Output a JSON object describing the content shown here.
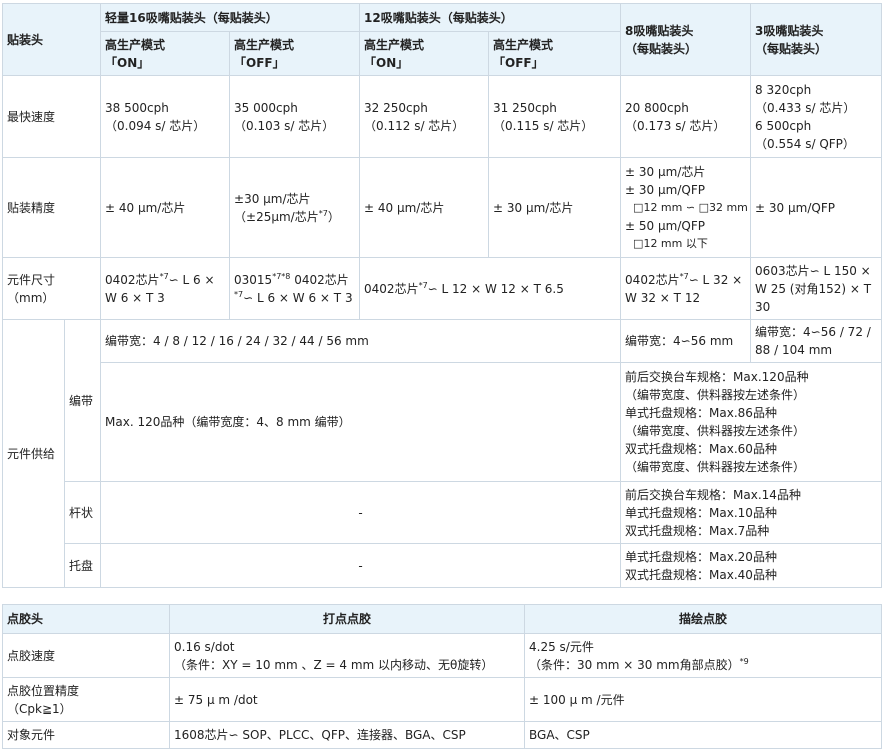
{
  "mount_table": {
    "corner": "贴装头",
    "head16": "轻量16吸嘴贴装头（每贴装头）",
    "head12": "12吸嘴贴装头（每贴装头）",
    "head8": [
      "8吸嘴贴装头",
      "（每贴装头）"
    ],
    "head3": [
      "3吸嘴贴装头",
      "（每贴装头）"
    ],
    "mode_on": [
      "高生产模式",
      "「ON」"
    ],
    "mode_off": [
      "高生产模式",
      "「OFF」"
    ],
    "rows": {
      "speed": {
        "label": "最快速度",
        "c16on": [
          "38 500cph",
          "（0.094 s/ 芯片）"
        ],
        "c16off": [
          "35 000cph",
          "（0.103 s/ 芯片）"
        ],
        "c12on": [
          "32 250cph",
          "（0.112 s/ 芯片）"
        ],
        "c12off": [
          "31 250cph",
          "（0.115 s/ 芯片）"
        ],
        "c8": [
          "20 800cph",
          "（0.173 s/ 芯片）"
        ],
        "c3": [
          "8 320cph",
          "（0.433 s/ 芯片）",
          "6 500cph",
          "（0.554 s/ QFP）"
        ]
      },
      "accuracy": {
        "label": "贴装精度",
        "c16on": "± 40 μm/芯片",
        "c16off_1": "±30 μm/芯片",
        "c16off_2": "（±25μm/芯片",
        "c16off_sup": "*7",
        "c16off_3": "）",
        "c12on": "± 40 μm/芯片",
        "c12off": "± 30 μm/芯片",
        "c8": [
          "± 30 μm/芯片",
          "± 30 μm/QFP",
          "□12 mm ∽ □32 mm",
          "± 50 μm/QFP",
          "□12 mm 以下"
        ],
        "c3": "± 30 μm/QFP"
      },
      "size": {
        "label": [
          "元件尺寸",
          "（mm）"
        ],
        "c16on_a": "0402芯片",
        "c16on_sup": "*7",
        "c16on_b": "∽ L 6 ×",
        "c16on_c": "W 6 × T 3",
        "c16off_a": "03015",
        "c16off_sup1": "*7*8",
        "c16off_b": " 0402芯片",
        "c16off_sup2": "*7",
        "c16off_c": "∽ L 6 × W 6 × T 3",
        "c12_a": "0402芯片",
        "c12_sup": "*7",
        "c12_b": "∽ L 12 × W 12 × T 6.5",
        "c8_a": "0402芯片",
        "c8_sup": "*7",
        "c8_b": "∽ L 32 ×",
        "c8_c": "W 32 × T 12",
        "c3": [
          "0603芯片∽ L 150 ×",
          "W 25 (对角152) ×",
          "T",
          "30"
        ]
      },
      "supply": {
        "label": "元件供给",
        "tape": {
          "label": "编带",
          "width_main": "编带宽：4 / 8 / 12 / 16 / 24 / 32 / 44 / 56 mm",
          "width_c8": "编带宽：4∽56 mm",
          "width_c3": [
            "编带宽：4∽56 / 72 /",
            "88 / 104 mm"
          ],
          "count_main": "Max. 120品种（编带宽度：4、8 mm 编带）",
          "count_right": [
            "前后交换台车规格：Max.120品种",
            "（编带宽度、供料器按左述条件）",
            "单式托盘规格：Max.86品种",
            "（编带宽度、供料器按左述条件）",
            "双式托盘规格：Max.60品种",
            "（编带宽度、供料器按左述条件）"
          ]
        },
        "stick": {
          "label": "杆状",
          "main": "-",
          "right": [
            "前后交换台车规格：Max.14品种",
            "单式托盘规格：Max.10品种",
            "双式托盘规格：Max.7品种"
          ]
        },
        "tray": {
          "label": "托盘",
          "main": "-",
          "right": [
            "单式托盘规格：Max.20品种",
            "双式托盘规格：Max.40品种"
          ]
        }
      }
    }
  },
  "glue_table": {
    "corner": "点胶头",
    "col_dot": "打点点胶",
    "col_draw": "描绘点胶",
    "rows": {
      "speed": {
        "label": "点胶速度",
        "dot": [
          "0.16 s/dot",
          "（条件：XY = 10 mm 、Z = 4 mm 以内移动、无θ旋转）"
        ],
        "draw_1": "4.25 s/元件",
        "draw_2": "（条件：30 mm × 30 mm角部点胶）",
        "draw_sup": "*9"
      },
      "accuracy": {
        "label": [
          "点胶位置精度",
          "（Cpk≧1）"
        ],
        "dot": "± 75 μ m /dot",
        "draw": "± 100 μ m /元件"
      },
      "target": {
        "label": "对象元件",
        "dot": "1608芯片∽ SOP、PLCC、QFP、连接器、BGA、CSP",
        "draw": "BGA、CSP"
      }
    }
  }
}
